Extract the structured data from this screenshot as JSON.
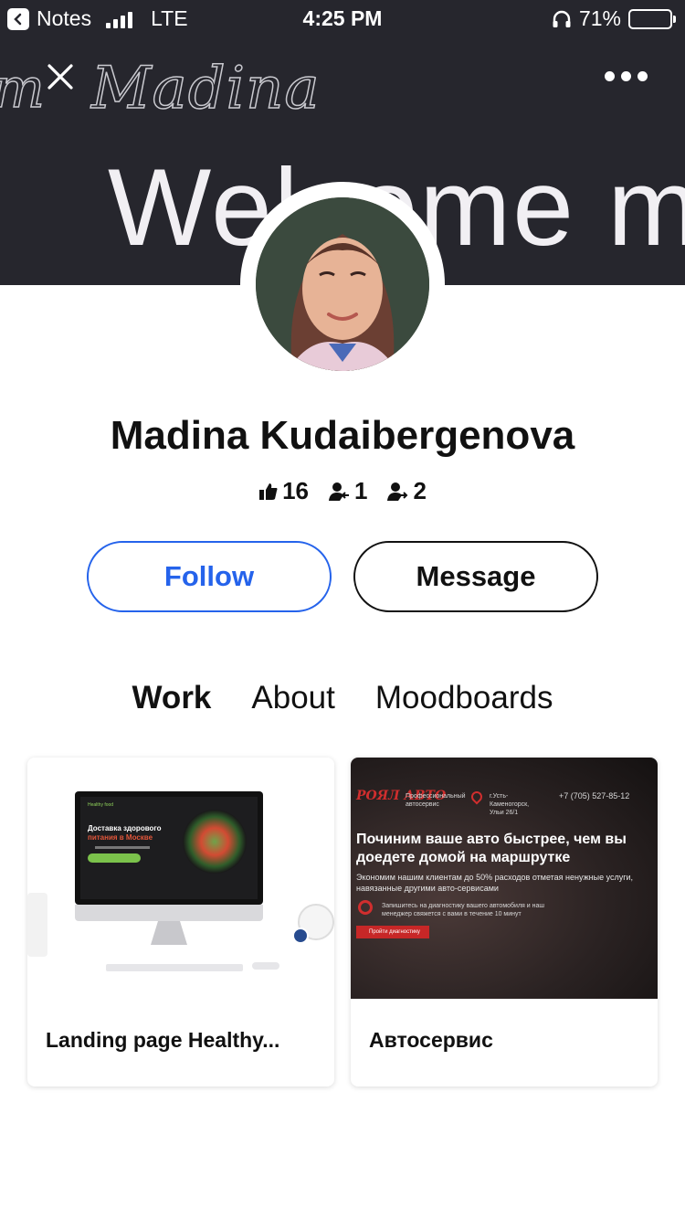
{
  "status_bar": {
    "back_app": "Notes",
    "network": "LTE",
    "time": "4:25 PM",
    "battery": "71%",
    "battery_level": 0.71
  },
  "hero": {
    "script_partial": "m",
    "script_name": "Madina",
    "welcome_text": "Welcome m"
  },
  "profile": {
    "name": "Madina Kudaibergenova",
    "stats": {
      "appreciations": "16",
      "followers": "1",
      "following": "2"
    }
  },
  "actions": {
    "follow_label": "Follow",
    "message_label": "Message"
  },
  "tabs": [
    {
      "label": "Work",
      "active": true
    },
    {
      "label": "About",
      "active": false
    },
    {
      "label": "Moodboards",
      "active": false
    }
  ],
  "projects": [
    {
      "title": "Landing page Healthy...",
      "thumb": {
        "brand": "Healthy food",
        "headline_1": "Доставка здорового",
        "headline_2": "питания в Москве"
      }
    },
    {
      "title": "Автосервис",
      "thumb": {
        "logo": "РОЯЛ АВТО",
        "tagline": "Профессиональный автосервис",
        "address": "г.Усть-Каменогорск, Ульи 26/1",
        "phone": "+7 (705) 527-85-12",
        "headline": "Починим ваше авто быстрее, чем вы доедете домой на маршрутке",
        "sub": "Экономим нашим клиентам до 50% расходов отметая ненужные услуги, навязанные другими авто-сервисами",
        "note": "Запишитесь на диагностику вашего автомобиля и наш менеджер свяжется с вами в течение 10 минут",
        "cta": "Пройти диагностику"
      }
    }
  ],
  "colors": {
    "hero_bg": "#26262d",
    "accent_blue": "#2563eb",
    "text": "#111111"
  }
}
